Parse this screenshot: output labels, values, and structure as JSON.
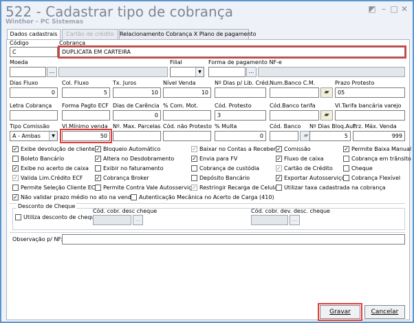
{
  "window": {
    "title": "522 - Cadastrar tipo de cobrança",
    "subtitle": "Winthor - PC Sistemas"
  },
  "tabs": [
    {
      "label": "Dados cadastrais",
      "state": "active"
    },
    {
      "label": "Cartão de crédito",
      "state": "disabled"
    },
    {
      "label": "Relacionamento Cobrança X Plano de pagamento",
      "state": "normal"
    }
  ],
  "fields": {
    "codigo": {
      "label": "Código",
      "value": "C"
    },
    "cobranca": {
      "label": "Cobrança",
      "value": "DUPLICATA EM CARTEIRA"
    },
    "moeda": {
      "label": "Moeda",
      "value": ""
    },
    "filial": {
      "label": "Filial",
      "value": ""
    },
    "forma_pag_nfe": {
      "label": "Forma de pagamento NF-e",
      "value": ""
    },
    "dias_fluxo": {
      "label": "Dias Fluxo",
      "value": "0"
    },
    "col_fluxo": {
      "label": "Col. Fluxo",
      "value": "5"
    },
    "tx_juros": {
      "label": "Tx. Juros",
      "value": "10"
    },
    "nivel_venda": {
      "label": "Nível Venda",
      "value": "10"
    },
    "nro_dias_lib": {
      "label": "Nº Dias p/ Lib. Créd.",
      "value": ""
    },
    "num_banco_cm": {
      "label": "Num.Banco C.M.",
      "value": ""
    },
    "prazo_protesto": {
      "label": "Prazo Protesto",
      "value": "05"
    },
    "letra_cobranca": {
      "label": "Letra Cobrança",
      "value": ""
    },
    "forma_pagto_ecf": {
      "label": "Forma Pagto ECF",
      "value": ""
    },
    "dias_carencia": {
      "label": "Dias de Carência",
      "value": "0"
    },
    "com_mot": {
      "label": "% Com. Mot.",
      "value": ""
    },
    "cod_protesto": {
      "label": "Cód. Protesto",
      "value": "3"
    },
    "cod_banco_tarifa": {
      "label": "Cód.Banco tarifa",
      "value": ""
    },
    "vl_tarifa": {
      "label": "Vl.Tarifa bancária varejo",
      "value": ""
    },
    "tipo_comissao": {
      "label": "Tipo Comissão",
      "value": "A - Ambas"
    },
    "vl_minimo_venda": {
      "label": "Vl.Mínimo venda",
      "value": "50"
    },
    "max_parcelas": {
      "label": "Nº. Max. Parcelas",
      "value": ""
    },
    "cod_nao_protesto": {
      "label": "Cód. não Protesto",
      "value": ""
    },
    "multa": {
      "label": "% Multa",
      "value": "0"
    },
    "cod_banco": {
      "label": "Cód. Banco",
      "value": ""
    },
    "dias_bloq_aut": {
      "label": "Nº Dias Bloq.Aut.",
      "value": "5"
    },
    "prz_max_venda": {
      "label": "Prz. Máx. Venda",
      "value": "999"
    }
  },
  "checkboxes": [
    {
      "label": "Exibe devolução de cliente",
      "checked": true,
      "disabled": false
    },
    {
      "label": "Bloqueio Automático",
      "checked": true,
      "disabled": false
    },
    {
      "label": "Baixar no Contas a Receber",
      "checked": true,
      "disabled": true
    },
    {
      "label": "Comissão",
      "checked": true,
      "disabled": false
    },
    {
      "label": "Permite Baixa Manual",
      "checked": true,
      "disabled": false
    },
    {
      "label": "Boleto Bancário",
      "checked": false,
      "disabled": false
    },
    {
      "label": "Altera no Desdobramento",
      "checked": true,
      "disabled": false
    },
    {
      "label": "Envia para FV",
      "checked": true,
      "disabled": false
    },
    {
      "label": "Fluxo de caixa",
      "checked": true,
      "disabled": false
    },
    {
      "label": "Cobrança em trânsito",
      "checked": false,
      "disabled": false
    },
    {
      "label": "Exibe no acerto de caixa",
      "checked": true,
      "disabled": false
    },
    {
      "label": "Exibir no faturamento",
      "checked": false,
      "disabled": false
    },
    {
      "label": "Cobrança de custódia",
      "checked": false,
      "disabled": false
    },
    {
      "label": "Cartão de Crédito",
      "checked": true,
      "disabled": true
    },
    {
      "label": "Cheque",
      "checked": false,
      "disabled": false
    },
    {
      "label": "Valida Lim.Crédito ECF",
      "checked": true,
      "disabled": true
    },
    {
      "label": "Cobrança Broker",
      "checked": true,
      "disabled": false
    },
    {
      "label": "Depósito Bancário",
      "checked": false,
      "disabled": false
    },
    {
      "label": "Exportar Autosserviço",
      "checked": true,
      "disabled": false
    },
    {
      "label": "Cobrança Flexível",
      "checked": false,
      "disabled": false
    },
    {
      "label": "Permite Seleção Cliente ECF",
      "checked": false,
      "disabled": false
    },
    {
      "label": "Permite Contra Vale Autosserviço",
      "checked": false,
      "disabled": false
    },
    {
      "label": "Restringir Recarga de Celular",
      "checked": true,
      "disabled": true
    },
    {
      "label": "Utilizar taxa cadastrada na cobrança",
      "checked": false,
      "disabled": false
    },
    {
      "label": "Não validar prazo médio no ato na venda",
      "checked": true,
      "disabled": false
    },
    {
      "label": "Autenticação Mecânica no Acerto de Carga (410)",
      "checked": false,
      "disabled": false
    }
  ],
  "cheque_group": {
    "title": "Desconto de Cheque",
    "utiliza_label": "Utiliza desconto de cheque",
    "cod_desc_label": "Cód. cobr. desc cheque",
    "cod_dev_desc_label": "Cód. cobr. dev. desc. cheque"
  },
  "observacao": {
    "label": "Observação p/ NF:",
    "value": ""
  },
  "buttons": {
    "gravar": "Gravar",
    "cancelar": "Cancelar"
  },
  "ellipsis": "...",
  "highlight_color": "#e53935"
}
